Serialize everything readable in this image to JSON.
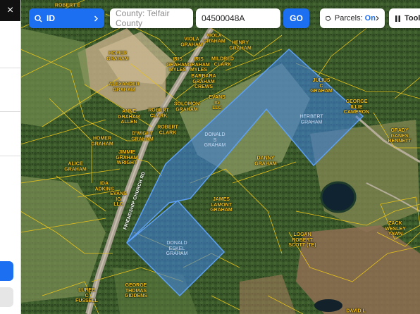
{
  "search": {
    "mode_label": "ID",
    "county_placeholder": "County: Telfair County",
    "parcel_value": "04500048A",
    "go_label": "GO"
  },
  "parcels_toggle": {
    "label": "Parcels:",
    "state": "On"
  },
  "tools_label": "Tools",
  "panel": {
    "close_glyph": "×"
  },
  "road_label": "FRIENDSHIP CHURCH RD",
  "owners": [
    "ROBERT E",
    "HOMER GRAHAM",
    "VIOLA GRAHAM",
    "VIOLA GRAHAM",
    "HENRY GRAHAM",
    "IRIS GRAHAM MYLES",
    "IRIS GRAHAM MYLES",
    "MILDRED CLARK",
    "BARBARA GRAHAM CREWS",
    "ALEXANDER GRAHAM",
    "JULIUS C GRAHAM",
    "GEORGE ILLIE CAMERON",
    "ANNE GRAHAM ALLEN",
    "ROBERT CLARK",
    "SOLOMON GRAHAM",
    "EVANS IG LLC",
    "HERBERT GRAHAM",
    "ROBERT CLARK",
    "D'WIGHT GRAHAM",
    "DONALD S GRAHAM",
    "GRADY GANES BENNETT",
    "HOMER GRAHAM",
    "JIMMIE GRAHAM WRIGHT",
    "DANNY GRAHAM",
    "ALICE GRAHAM",
    "IDA ADKINS",
    "EVANS IG LLC",
    "JAMES LAMONT GRAHAM",
    "ZACK WESLEY YAWN",
    "LOGAN ROBERT SCOTT (TE)",
    "DONALD ESKEL GRAHAM",
    "LUREE C FUSSELL",
    "GEORGE THOMAS GIDDENS",
    "DAVID L"
  ],
  "colors": {
    "accent": "#1d6ff2",
    "parcel_line": "#e8c21a",
    "selection_fill": "#3d7fd9"
  },
  "icons": [
    "search-icon",
    "chevron-right-icon",
    "parcels-icon",
    "tools-icon",
    "close-icon"
  ]
}
